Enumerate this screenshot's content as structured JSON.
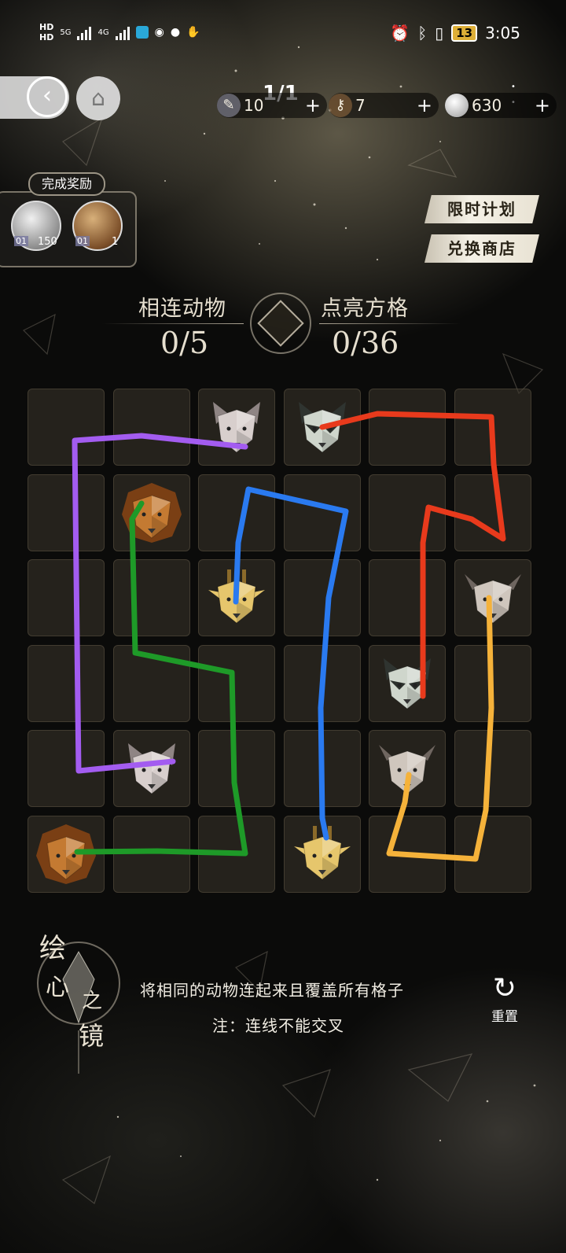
{
  "status_bar": {
    "hd1": "HD",
    "hd2": "HD",
    "net1": "5G",
    "net2": "4G",
    "battery": "13",
    "time": "3:05"
  },
  "top": {
    "page_indicator": "1/1",
    "resources": [
      {
        "name": "paint-brush",
        "value": "10",
        "plus": "+"
      },
      {
        "name": "key",
        "value": "7",
        "plus": "+"
      },
      {
        "name": "coin",
        "value": "630",
        "plus": "+"
      }
    ]
  },
  "reward": {
    "title": "完成奖励",
    "items": [
      {
        "icon": "coin-icon",
        "tag": "01",
        "count": "150"
      },
      {
        "icon": "key-icon",
        "tag": "01",
        "count": "1"
      }
    ]
  },
  "side_buttons": {
    "limited_plan": "限时计划",
    "exchange_shop": "兑换商店"
  },
  "score": {
    "connected_label": "相连动物",
    "connected_value": "0/5",
    "lit_label": "点亮方格",
    "lit_value": "0/36"
  },
  "grid": {
    "rows": 6,
    "cols": 6,
    "animals": [
      {
        "type": "cat",
        "row": 0,
        "col": 2
      },
      {
        "type": "raccoon",
        "row": 0,
        "col": 3
      },
      {
        "type": "lion",
        "row": 1,
        "col": 1
      },
      {
        "type": "giraffe",
        "row": 2,
        "col": 2
      },
      {
        "type": "bull",
        "row": 2,
        "col": 5
      },
      {
        "type": "raccoon",
        "row": 3,
        "col": 4
      },
      {
        "type": "cat",
        "row": 4,
        "col": 1
      },
      {
        "type": "bull",
        "row": 4,
        "col": 4
      },
      {
        "type": "lion",
        "row": 5,
        "col": 0
      },
      {
        "type": "giraffe",
        "row": 5,
        "col": 3
      }
    ],
    "paths": [
      {
        "color": "#a35cf0",
        "label": "cat"
      },
      {
        "color": "#e83a1c",
        "label": "raccoon"
      },
      {
        "color": "#1e9a28",
        "label": "lion"
      },
      {
        "color": "#2a7af0",
        "label": "giraffe"
      },
      {
        "color": "#f5b23a",
        "label": "bull"
      }
    ]
  },
  "logo_text": [
    "绘",
    "心",
    "之",
    "镜"
  ],
  "hint": {
    "line1": "将相同的动物连起来且覆盖所有格子",
    "line2": "注：连线不能交叉"
  },
  "reset_label": "重置"
}
